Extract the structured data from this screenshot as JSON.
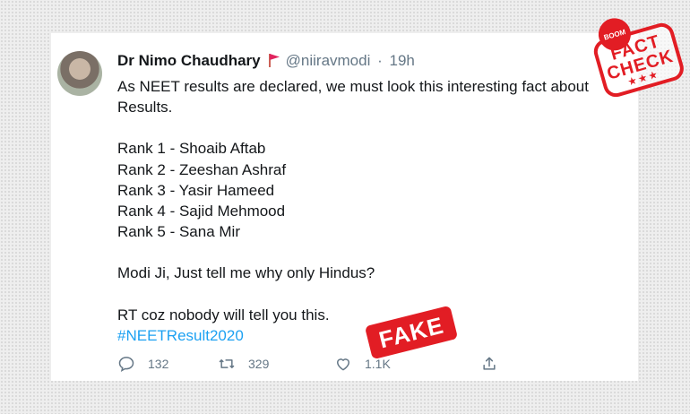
{
  "tweet": {
    "author_name": "Dr Nimo Chaudhary",
    "handle": "@niiravmodi",
    "separator": "·",
    "time": "19h",
    "lines": {
      "intro": "As NEET results are declared, we must look this interesting fact about Results.",
      "ranks": [
        "Rank 1 - Shoaib Aftab",
        "Rank 2 - Zeeshan Ashraf",
        "Rank 3 - Yasir Hameed",
        "Rank 4 - Sajid Mehmood",
        "Rank 5 - Sana Mir"
      ],
      "question": "Modi Ji, Just tell me why only Hindus?",
      "rt_line": "RT coz nobody will tell you this.",
      "hashtag": "#NEETResult2020"
    },
    "actions": {
      "reply_count": "132",
      "retweet_count": "329",
      "like_count": "1.1K"
    }
  },
  "overlays": {
    "fact_check": {
      "brand": "BOOM",
      "line1": "FACT",
      "line2": "CHECK",
      "stars": "★★★"
    },
    "fake_stamp": "FAKE"
  },
  "colors": {
    "stamp_red": "#e21d24",
    "link_blue": "#1da1f2",
    "muted_gray": "#657786",
    "text": "#14171a"
  },
  "icons": {
    "reply": "reply-icon",
    "retweet": "retweet-icon",
    "like": "heart-icon",
    "share": "share-icon",
    "flag": "flag-icon"
  }
}
